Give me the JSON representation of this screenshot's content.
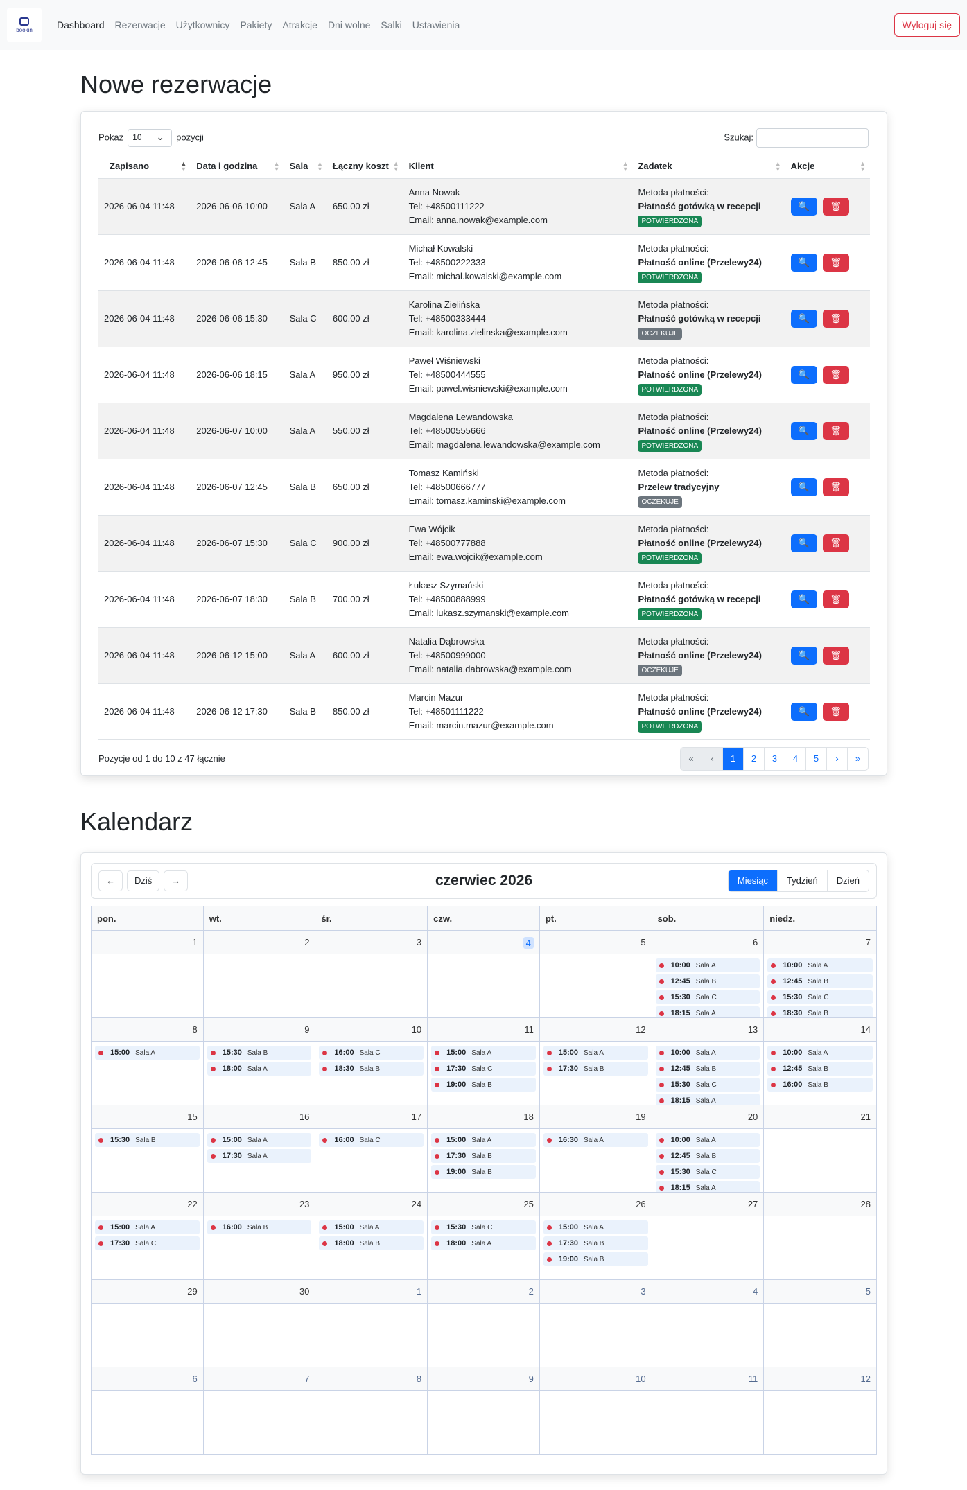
{
  "nav": {
    "logo_text": "bookin",
    "items": [
      {
        "label": "Dashboard",
        "active": true
      },
      {
        "label": "Rezerwacje"
      },
      {
        "label": "Użytkownicy"
      },
      {
        "label": "Pakiety"
      },
      {
        "label": "Atrakcje"
      },
      {
        "label": "Dni wolne"
      },
      {
        "label": "Salki"
      },
      {
        "label": "Ustawienia"
      }
    ],
    "logout": "Wyloguj się"
  },
  "reservations": {
    "title": "Nowe rezerwacje",
    "show_label": "Pokaż",
    "page_size": "10",
    "positions_label": "pozycji",
    "search_label": "Szukaj:",
    "columns": [
      "Zapisano",
      "Data i godzina",
      "Sala",
      "Łączny koszt",
      "Klient",
      "Zadatek",
      "Akcje"
    ],
    "rows": [
      {
        "saved": "2026-06-04 11:48",
        "date": "2026-06-06 10:00",
        "room": "Sala A",
        "cost": "650.00 zł",
        "name": "Anna Nowak",
        "tel": "Tel: +48500111222",
        "email": "Email: anna.nowak@example.com",
        "method_label": "Metoda płatności:",
        "method": "Płatność gotówką w recepcji",
        "status": "POTWIERDZONA"
      },
      {
        "saved": "2026-06-04 11:48",
        "date": "2026-06-06 12:45",
        "room": "Sala B",
        "cost": "850.00 zł",
        "name": "Michał Kowalski",
        "tel": "Tel: +48500222333",
        "email": "Email: michal.kowalski@example.com",
        "method_label": "Metoda płatności:",
        "method": "Płatność online (Przelewy24)",
        "status": "POTWIERDZONA"
      },
      {
        "saved": "2026-06-04 11:48",
        "date": "2026-06-06 15:30",
        "room": "Sala C",
        "cost": "600.00 zł",
        "name": "Karolina Zielińska",
        "tel": "Tel: +48500333444",
        "email": "Email: karolina.zielinska@example.com",
        "method_label": "Metoda płatności:",
        "method": "Płatność gotówką w recepcji",
        "status": "OCZEKUJE"
      },
      {
        "saved": "2026-06-04 11:48",
        "date": "2026-06-06 18:15",
        "room": "Sala A",
        "cost": "950.00 zł",
        "name": "Paweł Wiśniewski",
        "tel": "Tel: +48500444555",
        "email": "Email: pawel.wisniewski@example.com",
        "method_label": "Metoda płatności:",
        "method": "Płatność online (Przelewy24)",
        "status": "POTWIERDZONA"
      },
      {
        "saved": "2026-06-04 11:48",
        "date": "2026-06-07 10:00",
        "room": "Sala A",
        "cost": "550.00 zł",
        "name": "Magdalena Lewandowska",
        "tel": "Tel: +48500555666",
        "email": "Email: magdalena.lewandowska@example.com",
        "method_label": "Metoda płatności:",
        "method": "Płatność online (Przelewy24)",
        "status": "POTWIERDZONA"
      },
      {
        "saved": "2026-06-04 11:48",
        "date": "2026-06-07 12:45",
        "room": "Sala B",
        "cost": "650.00 zł",
        "name": "Tomasz Kamiński",
        "tel": "Tel: +48500666777",
        "email": "Email: tomasz.kaminski@example.com",
        "method_label": "Metoda płatności:",
        "method": "Przelew tradycyjny",
        "status": "OCZEKUJE"
      },
      {
        "saved": "2026-06-04 11:48",
        "date": "2026-06-07 15:30",
        "room": "Sala C",
        "cost": "900.00 zł",
        "name": "Ewa Wójcik",
        "tel": "Tel: +48500777888",
        "email": "Email: ewa.wojcik@example.com",
        "method_label": "Metoda płatności:",
        "method": "Płatność online (Przelewy24)",
        "status": "POTWIERDZONA"
      },
      {
        "saved": "2026-06-04 11:48",
        "date": "2026-06-07 18:30",
        "room": "Sala B",
        "cost": "700.00 zł",
        "name": "Łukasz Szymański",
        "tel": "Tel: +48500888999",
        "email": "Email: lukasz.szymanski@example.com",
        "method_label": "Metoda płatności:",
        "method": "Płatność gotówką w recepcji",
        "status": "POTWIERDZONA"
      },
      {
        "saved": "2026-06-04 11:48",
        "date": "2026-06-12 15:00",
        "room": "Sala A",
        "cost": "600.00 zł",
        "name": "Natalia Dąbrowska",
        "tel": "Tel: +48500999000",
        "email": "Email: natalia.dabrowska@example.com",
        "method_label": "Metoda płatności:",
        "method": "Płatność online (Przelewy24)",
        "status": "OCZEKUJE"
      },
      {
        "saved": "2026-06-04 11:48",
        "date": "2026-06-12 17:30",
        "room": "Sala B",
        "cost": "850.00 zł",
        "name": "Marcin Mazur",
        "tel": "Tel: +48501111222",
        "email": "Email: marcin.mazur@example.com",
        "method_label": "Metoda płatności:",
        "method": "Płatność online (Przelewy24)",
        "status": "POTWIERDZONA"
      }
    ],
    "info": "Pozycje od 1 do 10 z 47 łącznie",
    "pager": [
      {
        "t": "«",
        "c": "dis"
      },
      {
        "t": "‹",
        "c": "dis"
      },
      {
        "t": "1",
        "c": "act"
      },
      {
        "t": "2",
        "c": ""
      },
      {
        "t": "3",
        "c": ""
      },
      {
        "t": "4",
        "c": ""
      },
      {
        "t": "5",
        "c": ""
      },
      {
        "t": "›",
        "c": ""
      },
      {
        "t": "»",
        "c": ""
      }
    ]
  },
  "calendar": {
    "title": "Kalendarz",
    "month": "czerwiec 2026",
    "prev": "←",
    "today": "Dziś",
    "next": "→",
    "views": [
      "Miesiąc",
      "Tydzień",
      "Dzień"
    ],
    "weekdays": [
      "pon.",
      "wt.",
      "śr.",
      "czw.",
      "pt.",
      "sob.",
      "niedz."
    ],
    "days": [
      {
        "n": "1",
        "ev": []
      },
      {
        "n": "2",
        "ev": []
      },
      {
        "n": "3",
        "ev": []
      },
      {
        "n": "4",
        "today": true,
        "ev": []
      },
      {
        "n": "5",
        "ev": []
      },
      {
        "n": "6",
        "ev": [
          [
            "10:00",
            "Sala A"
          ],
          [
            "12:45",
            "Sala B"
          ],
          [
            "15:30",
            "Sala C"
          ],
          [
            "18:15",
            "Sala A"
          ]
        ]
      },
      {
        "n": "7",
        "ev": [
          [
            "10:00",
            "Sala A"
          ],
          [
            "12:45",
            "Sala B"
          ],
          [
            "15:30",
            "Sala C"
          ],
          [
            "18:30",
            "Sala B"
          ]
        ]
      },
      {
        "n": "8",
        "ev": [
          [
            "15:00",
            "Sala A"
          ]
        ]
      },
      {
        "n": "9",
        "ev": [
          [
            "15:30",
            "Sala B"
          ],
          [
            "18:00",
            "Sala A"
          ]
        ]
      },
      {
        "n": "10",
        "ev": [
          [
            "16:00",
            "Sala C"
          ],
          [
            "18:30",
            "Sala B"
          ]
        ]
      },
      {
        "n": "11",
        "ev": [
          [
            "15:00",
            "Sala A"
          ],
          [
            "17:30",
            "Sala C"
          ],
          [
            "19:00",
            "Sala B"
          ]
        ]
      },
      {
        "n": "12",
        "ev": [
          [
            "15:00",
            "Sala A"
          ],
          [
            "17:30",
            "Sala B"
          ]
        ]
      },
      {
        "n": "13",
        "ev": [
          [
            "10:00",
            "Sala A"
          ],
          [
            "12:45",
            "Sala B"
          ],
          [
            "15:30",
            "Sala C"
          ],
          [
            "18:15",
            "Sala A"
          ]
        ]
      },
      {
        "n": "14",
        "ev": [
          [
            "10:00",
            "Sala A"
          ],
          [
            "12:45",
            "Sala B"
          ],
          [
            "16:00",
            "Sala B"
          ]
        ]
      },
      {
        "n": "15",
        "ev": [
          [
            "15:30",
            "Sala B"
          ]
        ]
      },
      {
        "n": "16",
        "ev": [
          [
            "15:00",
            "Sala A"
          ],
          [
            "17:30",
            "Sala A"
          ]
        ]
      },
      {
        "n": "17",
        "ev": [
          [
            "16:00",
            "Sala C"
          ]
        ]
      },
      {
        "n": "18",
        "ev": [
          [
            "15:00",
            "Sala A"
          ],
          [
            "17:30",
            "Sala B"
          ],
          [
            "19:00",
            "Sala B"
          ]
        ]
      },
      {
        "n": "19",
        "ev": [
          [
            "16:30",
            "Sala A"
          ]
        ]
      },
      {
        "n": "20",
        "ev": [
          [
            "10:00",
            "Sala A"
          ],
          [
            "12:45",
            "Sala B"
          ],
          [
            "15:30",
            "Sala C"
          ],
          [
            "18:15",
            "Sala A"
          ]
        ]
      },
      {
        "n": "21",
        "ev": []
      },
      {
        "n": "22",
        "ev": [
          [
            "15:00",
            "Sala A"
          ],
          [
            "17:30",
            "Sala C"
          ]
        ]
      },
      {
        "n": "23",
        "ev": [
          [
            "16:00",
            "Sala B"
          ]
        ]
      },
      {
        "n": "24",
        "ev": [
          [
            "15:00",
            "Sala A"
          ],
          [
            "18:00",
            "Sala B"
          ]
        ]
      },
      {
        "n": "25",
        "ev": [
          [
            "15:30",
            "Sala C"
          ],
          [
            "18:00",
            "Sala A"
          ]
        ]
      },
      {
        "n": "26",
        "ev": [
          [
            "15:00",
            "Sala A"
          ],
          [
            "17:30",
            "Sala B"
          ],
          [
            "19:00",
            "Sala B"
          ]
        ]
      },
      {
        "n": "27",
        "ev": []
      },
      {
        "n": "28",
        "ev": []
      },
      {
        "n": "29",
        "ev": []
      },
      {
        "n": "30",
        "ev": []
      },
      {
        "n": "1",
        "other": true,
        "ev": []
      },
      {
        "n": "2",
        "other": true,
        "ev": []
      },
      {
        "n": "3",
        "other": true,
        "ev": []
      },
      {
        "n": "4",
        "other": true,
        "ev": []
      },
      {
        "n": "5",
        "other": true,
        "ev": []
      },
      {
        "n": "6",
        "other": true,
        "ev": []
      },
      {
        "n": "7",
        "other": true,
        "ev": []
      },
      {
        "n": "8",
        "other": true,
        "ev": []
      },
      {
        "n": "9",
        "other": true,
        "ev": []
      },
      {
        "n": "10",
        "other": true,
        "ev": []
      },
      {
        "n": "11",
        "other": true,
        "ev": []
      },
      {
        "n": "12",
        "other": true,
        "ev": []
      }
    ]
  }
}
